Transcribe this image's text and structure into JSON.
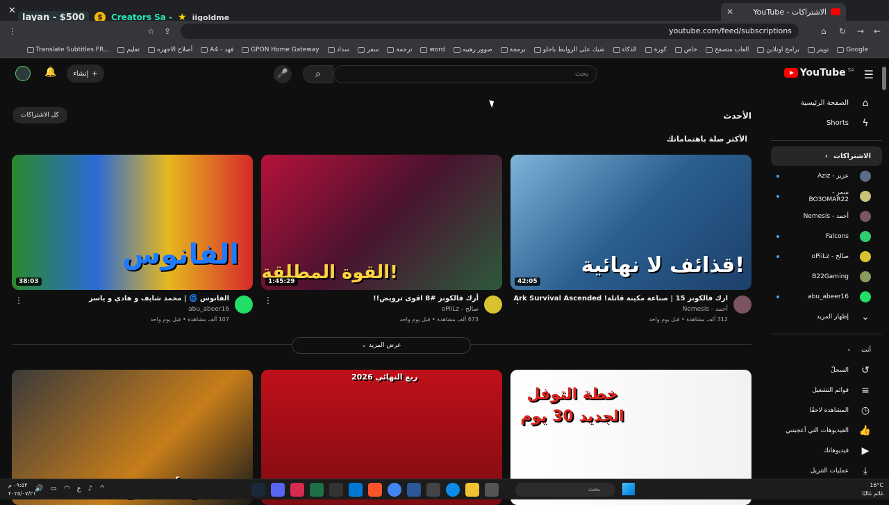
{
  "browser": {
    "tab_title": "الاشتراكات - YouTube",
    "url": "youtube.com/feed/subscriptions",
    "overlay": {
      "name": "layan - $500",
      "coin": "$",
      "creators": "Creators Sa -",
      "handle": "iigoldme"
    }
  },
  "bookmarks": [
    "Google",
    "تويتر",
    "برامج اونلاين",
    "العاب متصفح",
    "خاص",
    "كورة",
    "الذكاء",
    "شيك على الروابط باحلو",
    "برمجة",
    "صوور رهيبه",
    "word",
    "ترجمة",
    "سفر",
    "سداد",
    "GPON Home Gateway",
    "A4 - فهد",
    "أصلاح الاجهزه",
    "تعليم",
    "Translate Subtitles FR..."
  ],
  "youtube": {
    "logo": "YouTube",
    "region": "SA",
    "search_placeholder": "بحث",
    "create_label": "إنشاء"
  },
  "sidebar": {
    "top": [
      {
        "label": "الصفحة الرئيسية",
        "icon": "home-icon",
        "glyph": "⌂"
      },
      {
        "label": "Shorts",
        "icon": "shorts-icon",
        "glyph": "ϟ"
      }
    ],
    "subscriptions_label": "الاشتراكات",
    "channels": [
      {
        "label": "عزيز - Aziz",
        "color": "#5b6b8c",
        "dot": true
      },
      {
        "label": "سمر - BO3OMAR22",
        "color": "#c9c07a",
        "dot": true
      },
      {
        "label": "أحمد - Nemesis",
        "color": "#7a5560",
        "dot": false
      },
      {
        "label": "Falcons",
        "color": "#2ecc71",
        "dot": true
      },
      {
        "label": "صالح - oPiiLz",
        "color": "#d9c230",
        "dot": true
      },
      {
        "label": "B22Gaming",
        "color": "#8a9a5b",
        "dot": false
      },
      {
        "label": "abu_abeer16",
        "color": "#22dd66",
        "dot": true
      }
    ],
    "show_more": "إظهار المزيد",
    "you_label": "أنت",
    "you_items": [
      {
        "label": "السجلّ",
        "icon": "history-icon",
        "glyph": "↺"
      },
      {
        "label": "قوائم التشغيل",
        "icon": "playlists-icon",
        "glyph": "≡"
      },
      {
        "label": "المشاهدة لاحقًا",
        "icon": "watch-later-icon",
        "glyph": "◷"
      },
      {
        "label": "الفيديوهات التي أعجبتني",
        "icon": "like-icon",
        "glyph": "👍"
      },
      {
        "label": "فيديوهاتك",
        "icon": "your-videos-icon",
        "glyph": "▶"
      },
      {
        "label": "عمليات التنزيل",
        "icon": "download-icon",
        "glyph": "⤓"
      }
    ]
  },
  "feed": {
    "latest_label": "الأحدث",
    "all_subs_label": "كل الاشتراكات",
    "relevant_label": "الأكثر صلة باهتماماتك",
    "show_more": "عرض المزيد",
    "videos": [
      {
        "title": "ارك فالكونز 15 | صناعة مكينة قاتلة! Ark Survival Ascended",
        "channel": "أحمد - Nemesis",
        "stats": "312 ألف مشاهدة • قبل يوم واحد",
        "duration": "42:05",
        "thumb_text": "قذائف لا نهائية!",
        "bg": "linear-gradient(135deg,#7fb3d9 0%,#2a5f8f 50%,#1d3f6b 100%)",
        "avatar": "#7a5560"
      },
      {
        "title": "أرك فالكونز #8 اقوى ترويض!!",
        "channel": "صالح - oPiiLz",
        "stats": "673 ألف مشاهدة • قبل يوم واحد",
        "duration": "1:45:29",
        "thumb_text": "القوة المطلقة!",
        "bg": "linear-gradient(135deg,#b5123a 0%,#4b1230 50%,#2c5a3b 100%)",
        "avatar": "#d9c230"
      },
      {
        "title": "الفانوس 🌀 | محمد شايف و هادي و ياسر",
        "channel": "abu_abeer16",
        "stats": "107 ألف مشاهدة • قبل يوم واحد",
        "duration": "38:03",
        "thumb_text": "الفانوس",
        "bg": "linear-gradient(90deg,#2a8a2a 0%,#2a6ad6 35%,#e6b81e 65%,#d62a2a 100%)",
        "avatar": "#22dd66"
      },
      {
        "title": "",
        "channel": "",
        "stats": "",
        "duration": "",
        "thumb_text": "خطة التوفل الجديد 30 يوم",
        "bg": "linear-gradient(90deg,#ffffff 0%,#f2f2f2 100%)",
        "avatar": ""
      },
      {
        "title": "",
        "channel": "",
        "stats": "",
        "duration": "",
        "thumb_text": "2026 ربع النهائي",
        "bg": "linear-gradient(180deg,#c0101a 0%,#7d0c12 100%)",
        "avatar": ""
      },
      {
        "title": "",
        "channel": "",
        "stats": "",
        "duration": "",
        "thumb_text": "حبس أنفاس",
        "bg": "linear-gradient(135deg,#3a3a3a 0%,#c77d1a 60%,#1a1a1a 100%)",
        "avatar": ""
      }
    ]
  },
  "taskbar": {
    "search": "بحث",
    "weather_temp": "16°C",
    "weather_desc": "غائم غالبًا",
    "time": "٠٩:٥٣ م",
    "date": "٢٠٢٥/٠٧/٢١"
  }
}
